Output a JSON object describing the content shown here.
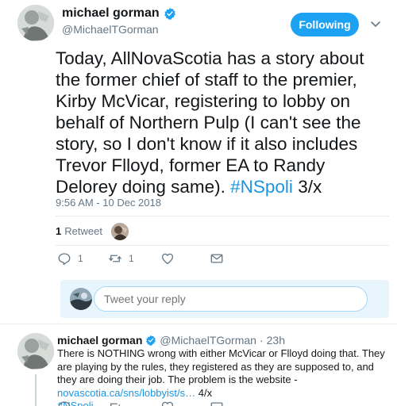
{
  "tweet": {
    "display_name": "michael gorman",
    "handle": "@MichaelTGorman",
    "follow_label": "Following",
    "text_main": "Today, AllNovaScotia has a story about the former chief of staff to the premier, Kirby McVicar, registering to lobby on behalf of Northern Pulp (I can't see the story, so I don't know if it also includes Trevor Flloyd, former EA to Randy Delorey doing same).",
    "hashtag": "#NSpoli",
    "text_tail": "3/x",
    "timestamp": "9:56 AM - 10 Dec 2018",
    "retweet_count": "1",
    "retweet_label": "Retweet",
    "reply_count": "1",
    "retweet_action_count": "1"
  },
  "reply_box": {
    "placeholder": "Tweet your reply"
  },
  "reply_tweet": {
    "display_name": "michael gorman",
    "handle": "@MichaelTGorman",
    "separator": "·",
    "time": "23h",
    "text_main": "There is NOTHING wrong with either McVicar or Flloyd doing that. They are playing by the rules, they registered as they are supposed to, and they are doing their job. The problem is the website -",
    "link": "novascotia.ca/sns/lobbyist/s…",
    "text_tail": "4/x",
    "hashtag": "#NSpoli"
  },
  "colors": {
    "accent": "#1da1f2",
    "link": "#1b95e0",
    "muted": "#657786",
    "text": "#14171a",
    "reply_bg": "#e8f5fd"
  },
  "icons": {
    "verified": "verified-badge-icon",
    "caret": "chevron-down-icon",
    "reply": "reply-icon",
    "retweet": "retweet-icon",
    "like": "heart-icon",
    "dm": "envelope-icon"
  }
}
